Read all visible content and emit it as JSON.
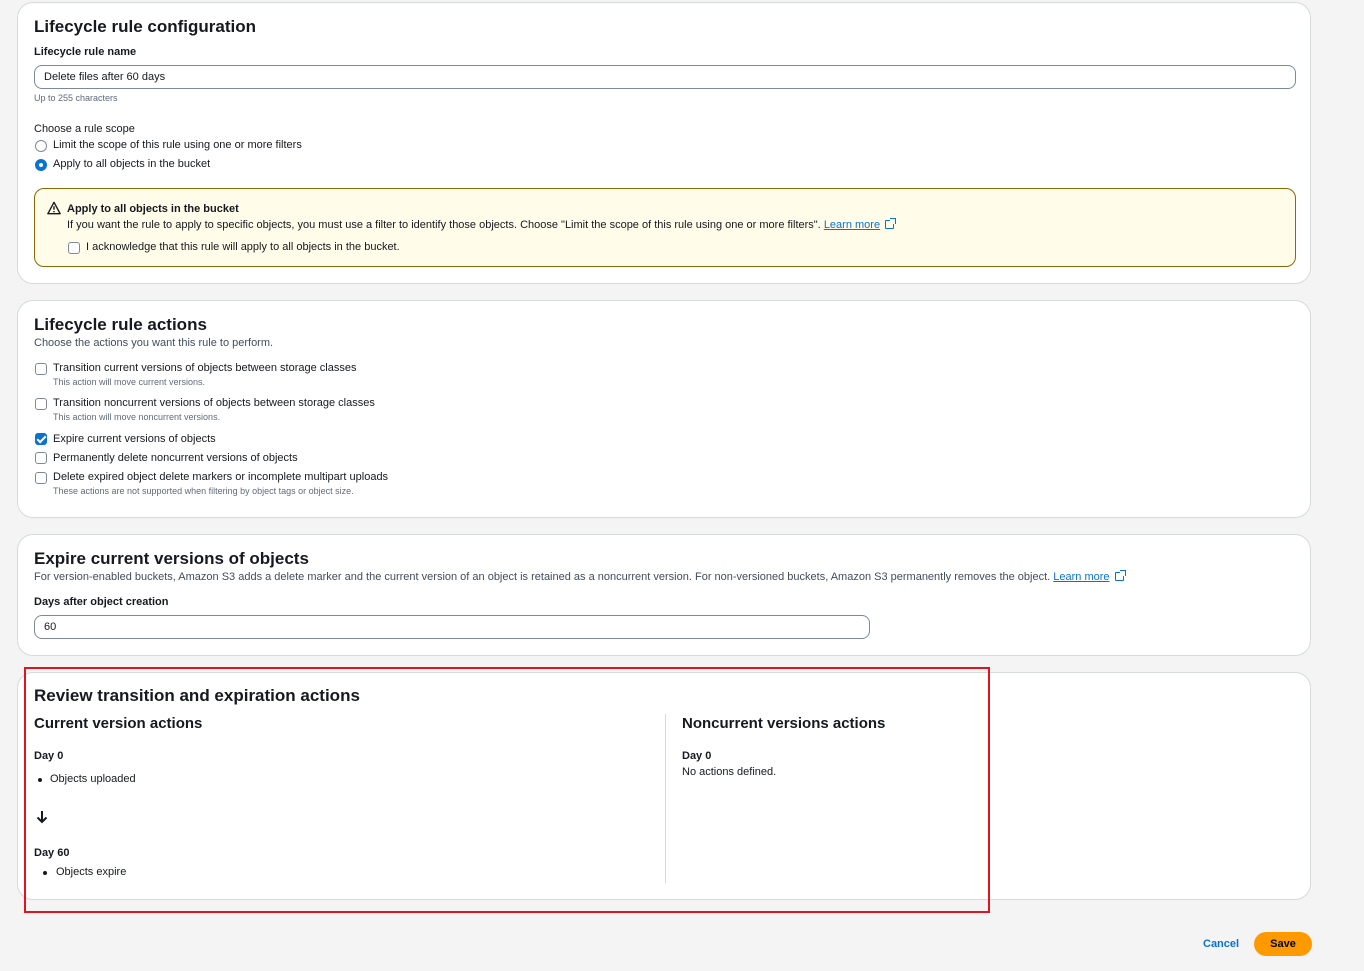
{
  "config": {
    "title": "Lifecycle rule configuration",
    "name_label": "Lifecycle rule name",
    "name_value": "Delete files after 60 days",
    "name_hint": "Up to 255 characters",
    "scope_label": "Choose a rule scope",
    "scope_options": [
      {
        "label": "Limit the scope of this rule using one or more filters",
        "selected": false
      },
      {
        "label": "Apply to all objects in the bucket",
        "selected": true
      }
    ],
    "alert": {
      "title": "Apply to all objects in the bucket",
      "body": "If you want the rule to apply to specific objects, you must use a filter to identify those objects. Choose \"Limit the scope of this rule using one or more filters\".",
      "link": "Learn more",
      "ack_label": "I acknowledge that this rule will apply to all objects in the bucket.",
      "ack_checked": false
    }
  },
  "actions": {
    "title": "Lifecycle rule actions",
    "subtitle": "Choose the actions you want this rule to perform.",
    "items": [
      {
        "label": "Transition current versions of objects between storage classes",
        "hint": "This action will move current versions.",
        "checked": false
      },
      {
        "label": "Transition noncurrent versions of objects between storage classes",
        "hint": "This action will move noncurrent versions.",
        "checked": false
      },
      {
        "label": "Expire current versions of objects",
        "hint": "",
        "checked": true
      },
      {
        "label": "Permanently delete noncurrent versions of objects",
        "hint": "",
        "checked": false
      },
      {
        "label": "Delete expired object delete markers or incomplete multipart uploads",
        "hint": "These actions are not supported when filtering by object tags or object size.",
        "checked": false
      }
    ]
  },
  "expire": {
    "title": "Expire current versions of objects",
    "desc": "For version-enabled buckets, Amazon S3 adds a delete marker and the current version of an object is retained as a noncurrent version. For non-versioned buckets, Amazon S3 permanently removes the object.",
    "link": "Learn more",
    "days_label": "Days after object creation",
    "days_value": "60"
  },
  "review": {
    "title": "Review transition and expiration actions",
    "current": {
      "title": "Current version actions",
      "day0": "Day 0",
      "day0_item": "Objects uploaded",
      "day60": "Day 60",
      "day60_item": "Objects expire"
    },
    "noncurrent": {
      "title": "Noncurrent versions actions",
      "day0": "Day 0",
      "none": "No actions defined."
    }
  },
  "footer": {
    "cancel": "Cancel",
    "save": "Save"
  },
  "colors": {
    "accent": "#0972d3",
    "primary_button": "#ff9900",
    "warning_border": "#8d6605",
    "warning_bg": "#fffce9",
    "highlight": "#e0141e"
  }
}
